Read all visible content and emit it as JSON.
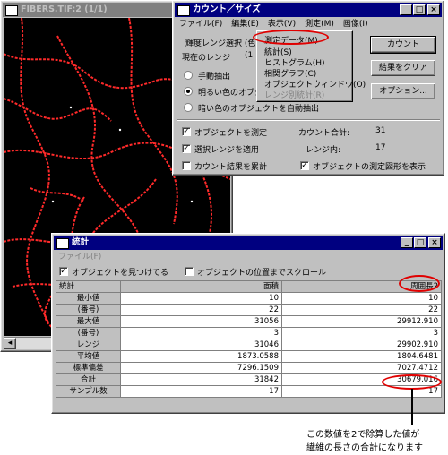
{
  "image_window": {
    "title": "FIBERS.TIF:2 (1/1)"
  },
  "count_window": {
    "title": "カウント／サイズ",
    "menu": [
      "ファイル(F)",
      "編集(E)",
      "表示(V)",
      "測定(M)",
      "画像(I)"
    ],
    "range_select": "輝度レンジ選択 (色",
    "current_range": "現在のレンジ",
    "current_range_value": "(1",
    "radio_manual": "手動抽出",
    "radio_bright": "明るい色のオブジ",
    "radio_dark": "暗い色のオブジェクトを自動抽出",
    "btn_count": "カウント",
    "btn_clear": "結果をクリア",
    "btn_option": "オプション...",
    "chk_measure": "オブジェクトを測定",
    "chk_apply": "選択レンジを適用",
    "chk_cumulative": "カウント結果を累計",
    "chk_show_outline": "オブジェクトの測定図形を表示",
    "total_label": "カウント合計:",
    "total_value": "31",
    "in_range_label": "レンジ内:",
    "in_range_value": "17"
  },
  "dropdown": {
    "items": [
      "測定データ(M)",
      "統計(S)",
      "ヒストグラム(H)",
      "相関グラフ(C)",
      "オブジェクトウィンドウ(O)",
      "レンジ別統計(R)"
    ]
  },
  "stats_window": {
    "title": "統計",
    "menu": "ファイル(F)",
    "chk_find": "オブジェクトを見つけてる",
    "chk_scroll": "オブジェクトの位置までスクロール",
    "columns": [
      "統計",
      "面積",
      "周囲長2"
    ],
    "rows": [
      {
        "label": "最小値",
        "area": "10",
        "perim": "10"
      },
      {
        "label": "(番号)",
        "area": "22",
        "perim": "22"
      },
      {
        "label": "最大値",
        "area": "31056",
        "perim": "29912.910"
      },
      {
        "label": "(番号)",
        "area": "3",
        "perim": "3"
      },
      {
        "label": "レンジ",
        "area": "31046",
        "perim": "29902.910"
      },
      {
        "label": "平均値",
        "area": "1873.0588",
        "perim": "1804.6481"
      },
      {
        "label": "標準偏差",
        "area": "7296.1509",
        "perim": "7027.4712"
      },
      {
        "label": "合計",
        "area": "31842",
        "perim": "30679.016"
      },
      {
        "label": "サンプル数",
        "area": "17",
        "perim": "17"
      }
    ]
  },
  "annotation": {
    "line1": "この数値を2で除算した値が",
    "line2": "繊維の長さの合計になります"
  },
  "colors": {
    "fiber": "#ff2a2a",
    "title_active": "#000080",
    "annotation_red": "#e00000"
  }
}
